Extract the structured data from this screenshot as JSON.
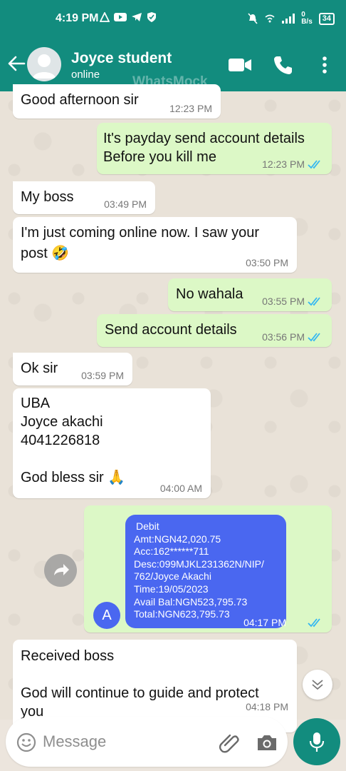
{
  "status_bar": {
    "time": "4:19 PM",
    "net_speed_top": "0",
    "net_speed_unit": "B/s",
    "battery": "34"
  },
  "header": {
    "contact_name": "Joyce student",
    "contact_status": "online",
    "watermark": "WhatsMock"
  },
  "messages": [
    {
      "dir": "in",
      "text": "Good afternoon sir",
      "time": "12:23 PM"
    },
    {
      "dir": "out",
      "text": "It's payday send account details\nBefore you kill me",
      "time": "12:23 PM"
    },
    {
      "dir": "in",
      "text": "My boss",
      "time": "03:49 PM"
    },
    {
      "dir": "in",
      "text": "I'm just coming online now. I saw your\npost 🤣",
      "time": "03:50 PM"
    },
    {
      "dir": "out",
      "text": "No wahala",
      "time": "03:55 PM"
    },
    {
      "dir": "out",
      "text": "Send account details",
      "time": "03:56 PM"
    },
    {
      "dir": "in",
      "text": "Ok sir",
      "time": "03:59 PM"
    },
    {
      "dir": "in",
      "text": "UBA\nJoyce akachi\n4041226818\n\nGod bless sir 🙏",
      "time": "04:00 AM"
    },
    {
      "dir": "out",
      "text": "",
      "time": "04:17 PM"
    },
    {
      "dir": "in",
      "text": "Received boss\n\nGod will continue to guide and protect\nyou",
      "time": "04:18 PM"
    }
  ],
  "debit_card": {
    "lines": [
      "Debit",
      "Amt:NGN42,020.75",
      "Acc:162******711",
      "Desc:099MJKL231362N/NIP/",
      "762/Joyce Akachi",
      "Time:19/05/2023",
      "Avail Bal:NGN523,795.73",
      "Total:NGN623,795.73"
    ],
    "badge": "A",
    "accent": "#4a67f0"
  },
  "input": {
    "placeholder": "Message"
  },
  "colors": {
    "header": "#128c7e",
    "outgoing": "#dcf8c6",
    "incoming": "#ffffff",
    "read_ticks": "#34b7f1"
  }
}
